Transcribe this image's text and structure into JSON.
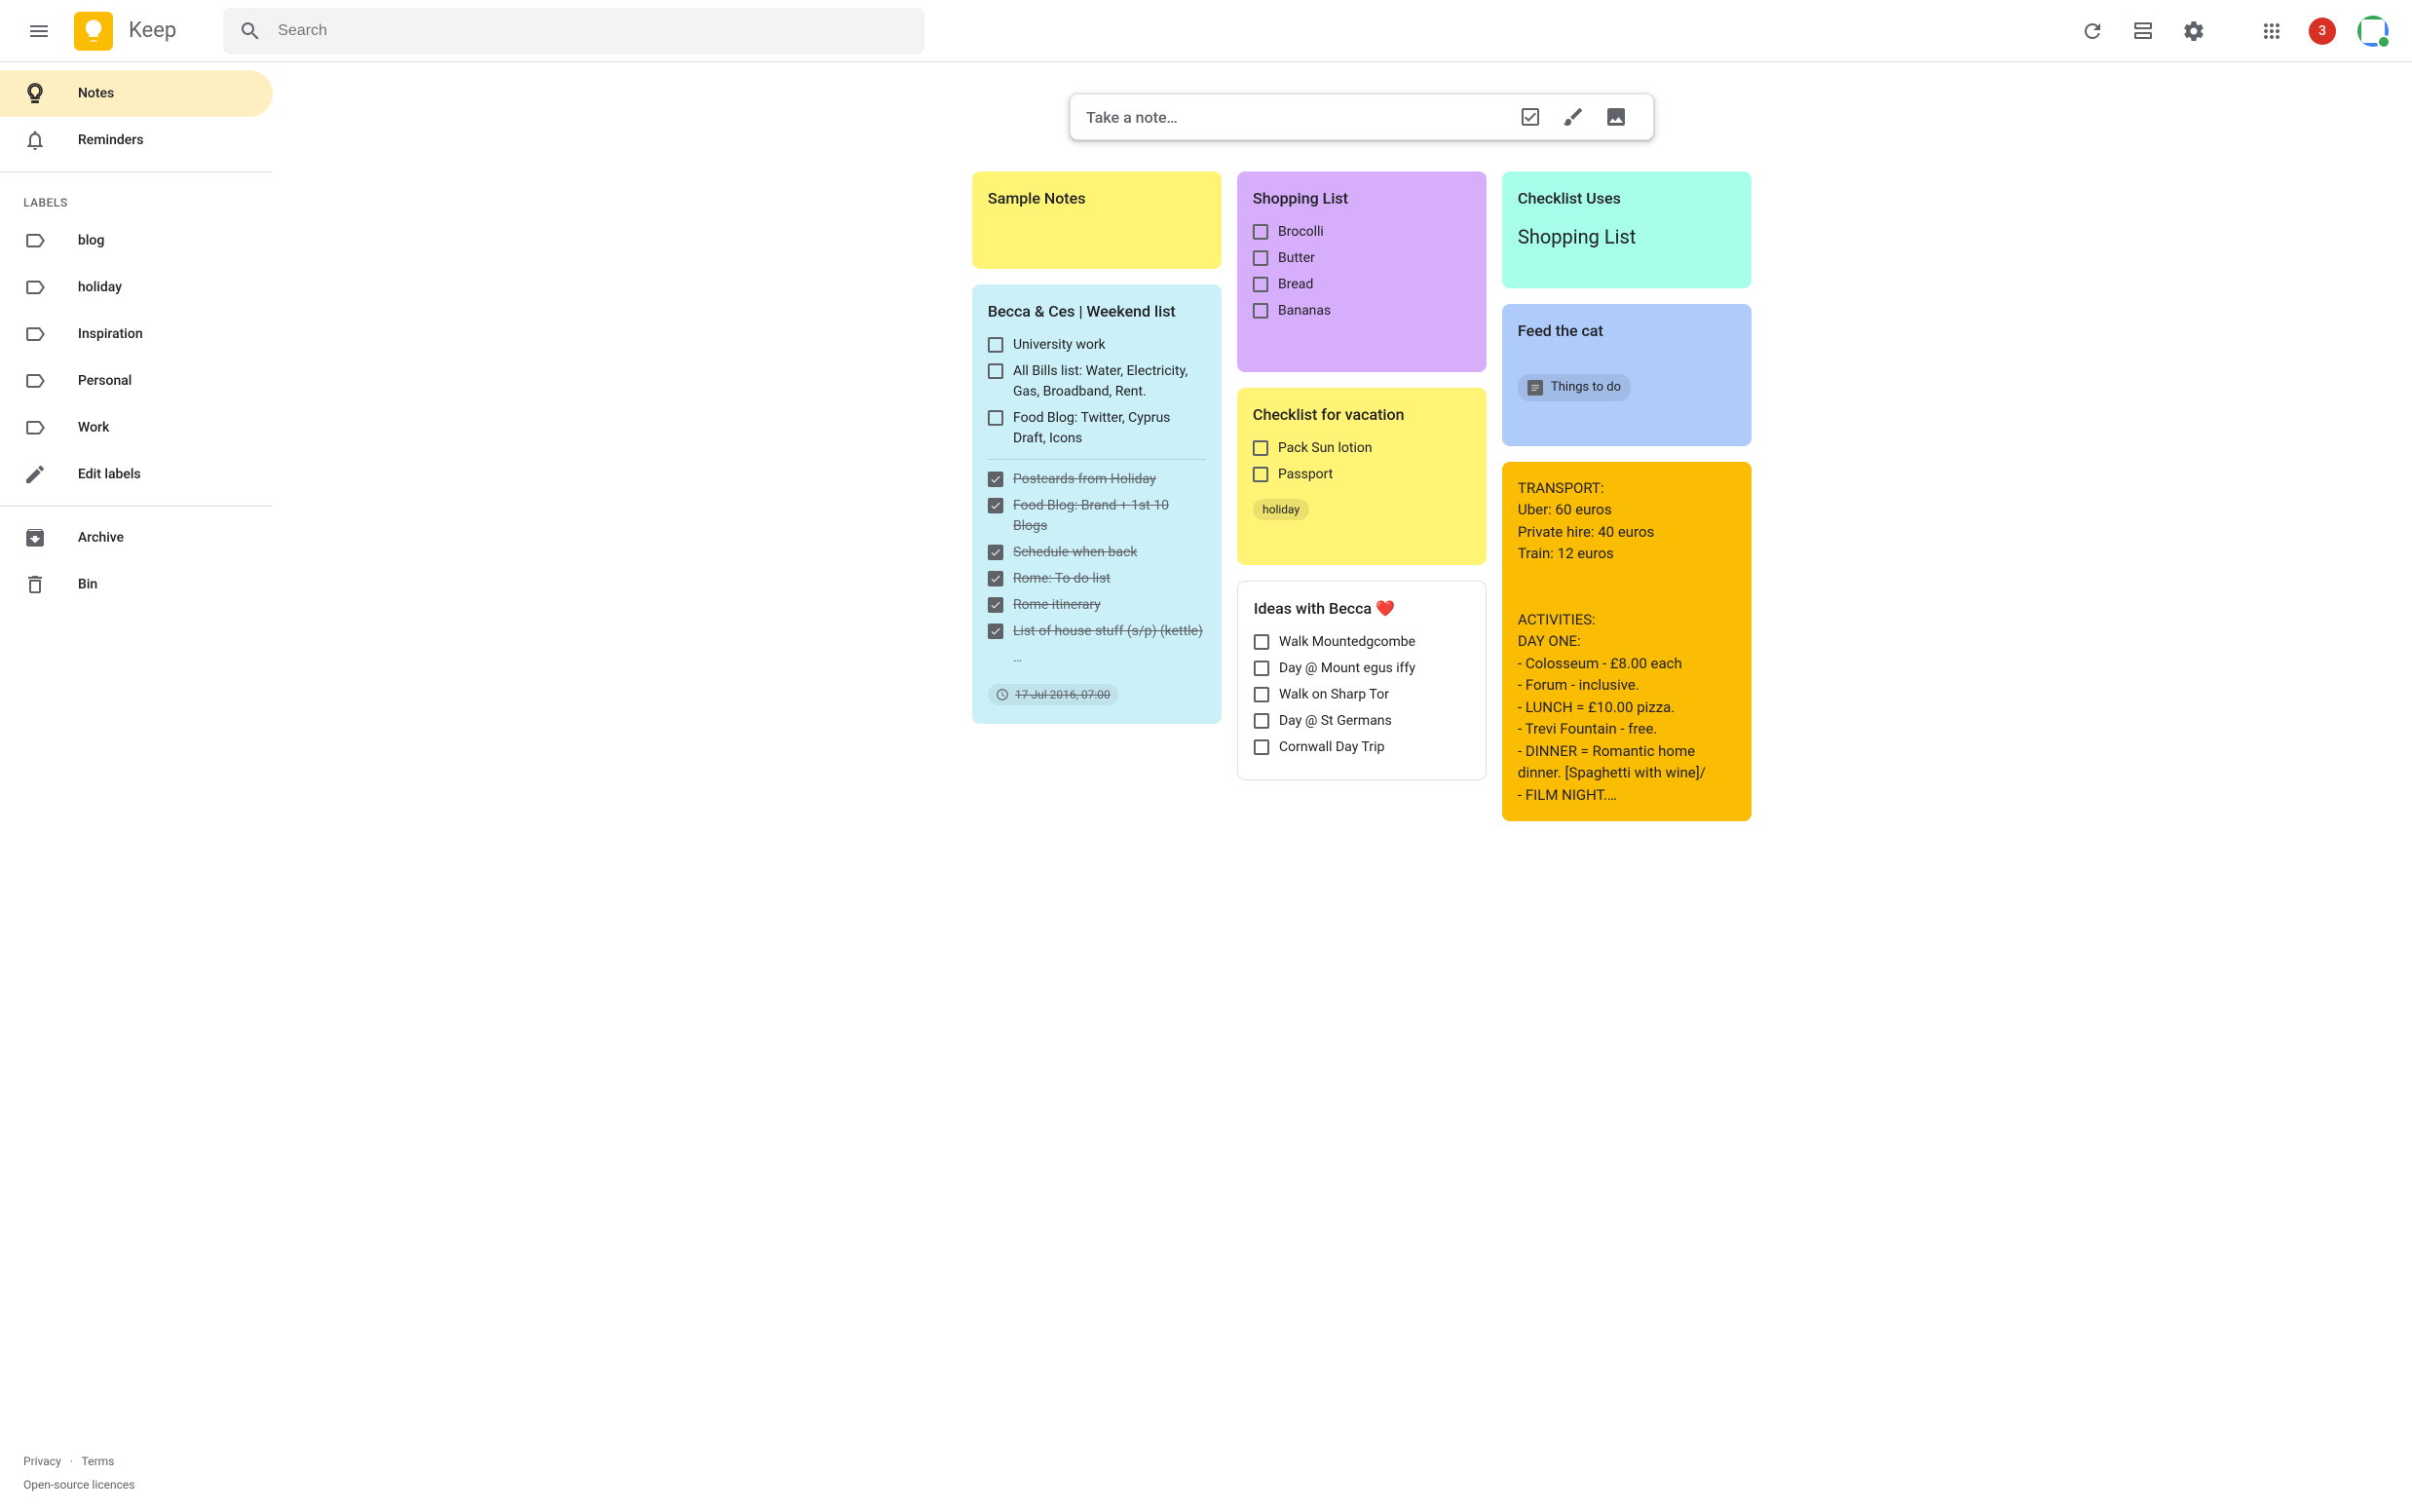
{
  "header": {
    "product_name": "Keep",
    "search_placeholder": "Search",
    "notification_count": "3"
  },
  "sidebar": {
    "notes": "Notes",
    "reminders": "Reminders",
    "labels_header": "LABELS",
    "labels": [
      "blog",
      "holiday",
      "Inspiration",
      "Personal",
      "Work"
    ],
    "edit_labels": "Edit labels",
    "archive": "Archive",
    "bin": "Bin",
    "footer": {
      "privacy": "Privacy",
      "dot": "·",
      "terms": "Terms",
      "licenses": "Open-source licences"
    }
  },
  "take_note": "Take a note…",
  "notes": {
    "sample": {
      "title": "Sample Notes"
    },
    "weekend": {
      "title": "Becca & Ces | Weekend list",
      "items_unchecked": [
        "University work",
        "All Bills list: Water, Electricity, Gas, Broadband, Rent.",
        "Food Blog: Twitter, Cyprus Draft, Icons"
      ],
      "items_checked": [
        "Postcards from Holiday",
        "Food Blog: Brand + 1st 10 Blogs",
        "Schedule when back",
        "Rome: To do list",
        "Rome itinerary",
        "List of house stuff (s/p) (kettle)"
      ],
      "more": "…",
      "reminder": "17 Jul 2016, 07:00"
    },
    "shopping": {
      "title": "Shopping List",
      "items": [
        "Brocolli",
        "Butter",
        "Bread",
        "Bananas"
      ]
    },
    "vacation": {
      "title": "Checklist for vacation",
      "items": [
        "Pack Sun lotion",
        "Passport"
      ],
      "label": "holiday"
    },
    "ideas": {
      "title": "Ideas with Becca ❤️",
      "items": [
        "Walk Mountedgcombe",
        "Day @ Mount egus iffy",
        "Walk on Sharp Tor",
        "Day @ St Germans",
        "Cornwall Day Trip"
      ]
    },
    "checklist_uses": {
      "title": "Checklist Uses",
      "subtitle": "Shopping List"
    },
    "feedcat": {
      "title": "Feed the cat",
      "chip": "Things to do"
    },
    "transport": {
      "body": "TRANSPORT:\nUber: 60 euros\nPrivate hire: 40 euros\nTrain: 12 euros\n\n\nACTIVITIES:\nDAY ONE:\n- Colosseum - £8.00 each\n- Forum - inclusive.\n- LUNCH = £10.00 pizza.\n- Trevi Fountain - free.\n- DINNER = Romantic home dinner. [Spaghetti with wine]/\n- FILM NIGHT.…"
    }
  }
}
